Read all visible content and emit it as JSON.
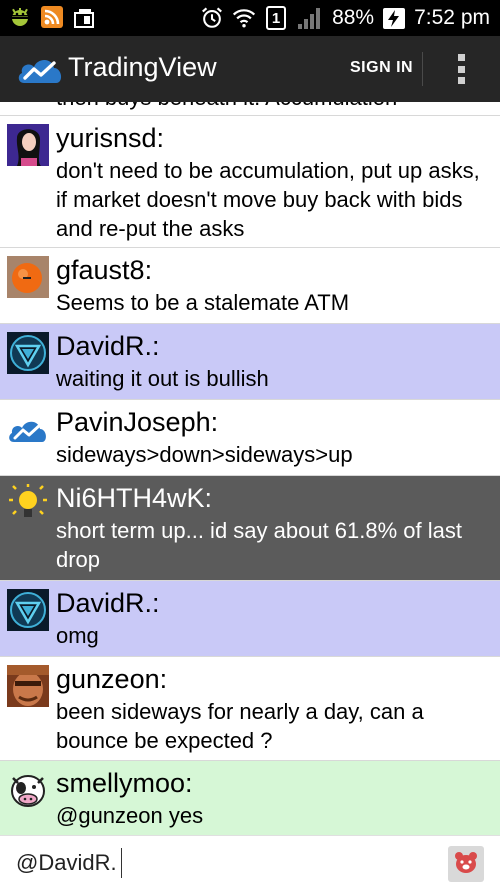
{
  "status_bar": {
    "battery": "88%",
    "time": "7:52 pm",
    "sim_slot": "1"
  },
  "app_bar": {
    "title": "TradingView",
    "sign_in_label": "SIGN IN"
  },
  "chat": {
    "partial_text": "then buys beneath it.  Accumulation",
    "messages": [
      {
        "user": "yurisnsd:",
        "text": "don't need to be accumulation, put up asks, if market doesn't move buy back with bids and re-put the asks",
        "avatar": "photo-avatar"
      },
      {
        "user": "gfaust8:",
        "text": "Seems to be a stalemate ATM",
        "avatar": "orange-ball-avatar"
      },
      {
        "user": "DavidR.:",
        "text": "waiting it out is bullish",
        "avatar": "shield-logo-avatar"
      },
      {
        "user": "PavinJoseph:",
        "text": "sideways>down>sideways>up",
        "avatar": "tradingview-cloud-avatar"
      },
      {
        "user": "Ni6HTH4wK:",
        "text": "short term up... id say about 61.8% of last drop",
        "avatar": "lightbulb-avatar"
      },
      {
        "user": "DavidR.:",
        "text": "omg",
        "avatar": "shield-logo-avatar"
      },
      {
        "user": "gunzeon:",
        "text": "been sideways for nearly a day, can a bounce be expected ?",
        "avatar": "face-photo-avatar"
      },
      {
        "user": "smellymoo:",
        "text": "@gunzeon yes",
        "avatar": "cow-avatar"
      }
    ]
  },
  "input": {
    "value": "@DavidR."
  },
  "colors": {
    "app_bar": "#262626",
    "highlight_lavender": "#c9c9f7",
    "highlight_dark": "#5b5b5b",
    "highlight_mint": "#d6f7d6",
    "brand_blue": "#2a78c8"
  }
}
